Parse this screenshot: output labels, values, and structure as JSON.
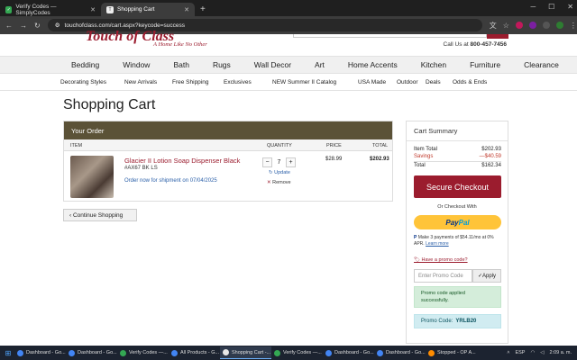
{
  "browser": {
    "tabs": [
      {
        "title": "Verify Codes — SimplyCodes",
        "active": false
      },
      {
        "title": "Shopping Cart",
        "active": true
      }
    ],
    "url": "touchofclass.com/cart.aspx?keycode=success",
    "new_tab": "+"
  },
  "site": {
    "logo": "Touch of Class",
    "tagline": "A Home Like No Other",
    "call_prefix": "Call Us at",
    "phone": "800-457-7456"
  },
  "main_nav": [
    "Bedding",
    "Window",
    "Bath",
    "Rugs",
    "Wall Decor",
    "Art",
    "Home Accents",
    "Kitchen",
    "Furniture",
    "Clearance"
  ],
  "sub_nav": [
    "Decorating Styles",
    "New Arrivals",
    "Free Shipping",
    "Exclusives",
    "NEW Summer II Catalog",
    "USA Made",
    "Outdoor",
    "Deals",
    "Odds & Ends"
  ],
  "page_title": "Shopping Cart",
  "order": {
    "header": "Your Order",
    "columns": {
      "item": "ITEM",
      "quantity": "QUANTITY",
      "price": "PRICE",
      "total": "TOTAL"
    },
    "item": {
      "name": "Glacier II Lotion Soap Dispenser Black",
      "sku": "#AX67 BK LS",
      "ship_note": "Order now for shipment on 07/04/2025",
      "quantity": "7",
      "minus": "−",
      "plus": "+",
      "update": "Update",
      "remove": "Remove",
      "price": "$28.99",
      "total": "$202.93"
    }
  },
  "continue_label": "Continue Shopping",
  "summary": {
    "title": "Cart Summary",
    "item_total_label": "Item Total",
    "item_total": "$202.93",
    "savings_label": "Savings",
    "savings": "—$40.59",
    "total_label": "Total",
    "total": "$162.34",
    "checkout_label": "Secure Checkout",
    "or_checkout": "Or Checkout With",
    "paypal_pay": "Pay",
    "paypal_pal": "Pal",
    "paypal_note": "Make 3 payments of $54.11/mo at 0% APR.",
    "learn_more": "Learn more",
    "promo_link": "Have a promo code?",
    "promo_placeholder": "Enter Promo Code",
    "apply_label": "Apply",
    "success_msg": "Promo code applied successfully.",
    "promo_code_label": "Promo Code:",
    "promo_code": "YRLB20"
  },
  "taskbar": {
    "items": [
      {
        "label": "Dashboard - Go...",
        "color": "#4285f4",
        "active": false
      },
      {
        "label": "Dashboard - Go...",
        "color": "#4285f4",
        "active": false
      },
      {
        "label": "Verify Codes —...",
        "color": "#34a853",
        "active": false
      },
      {
        "label": "All Products - G...",
        "color": "#4285f4",
        "active": false
      },
      {
        "label": "Shopping Cart -...",
        "color": "#e8e8e8",
        "active": true
      },
      {
        "label": "Verify Codes —...",
        "color": "#34a853",
        "active": false
      },
      {
        "label": "Dashboard - Go...",
        "color": "#4285f4",
        "active": false
      },
      {
        "label": "Dashboard - Go...",
        "color": "#4285f4",
        "active": false
      },
      {
        "label": "Stopped - OP A...",
        "color": "#ff8c00",
        "active": false
      }
    ],
    "lang": "ESP",
    "time": "2:09 a. m."
  },
  "colors": {
    "brand": "#9b1c2e",
    "order_header": "#5b5237",
    "link": "#2a5fa8"
  }
}
